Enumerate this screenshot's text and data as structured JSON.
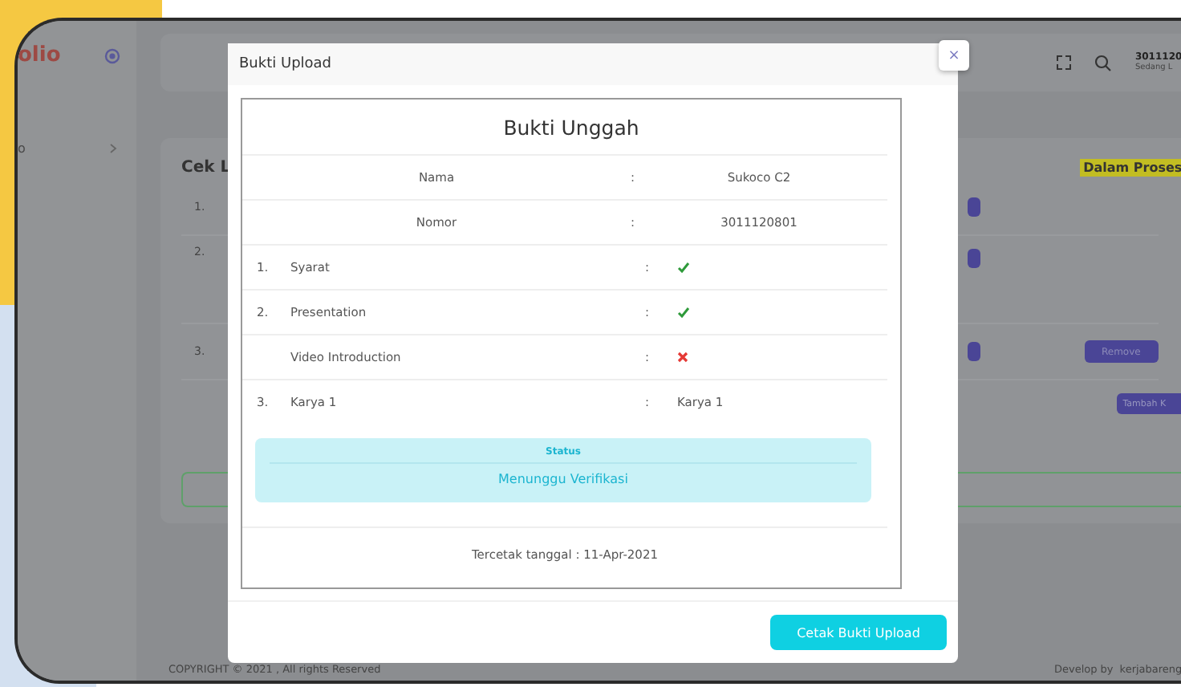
{
  "app": {
    "logo": "olio",
    "sidebar_items": [
      {
        "label": "o"
      }
    ],
    "header": {
      "user_id": "3011120",
      "user_status": "Sedang L"
    },
    "card": {
      "title": "Cek L",
      "badge": "Dalam Proses",
      "rows": [
        {
          "number": "1."
        },
        {
          "number": "2."
        },
        {
          "number": "3.",
          "action": "Remove"
        }
      ],
      "add_button": "Tambah K"
    },
    "footer": {
      "copyright": "COPYRIGHT © 2021 , All rights Reserved",
      "credit_label": "Develop by",
      "credit_link": "kerjabareng"
    }
  },
  "modal": {
    "title": "Bukti Upload",
    "close": "×",
    "heading": "Bukti Unggah",
    "info": [
      {
        "label": "Nama",
        "value": "Sukoco C2"
      },
      {
        "label": "Nomor",
        "value": "3011120801"
      }
    ],
    "separator": ":",
    "items": [
      {
        "number": "1.",
        "label": "Syarat",
        "ok": true
      },
      {
        "number": "2.",
        "label": "Presentation",
        "ok": true
      },
      {
        "label": "Video Introduction",
        "ok": false
      },
      {
        "number": "3.",
        "label": "Karya 1",
        "value": "Karya 1"
      }
    ],
    "status": {
      "title": "Status",
      "text": "Menunggu Verifikasi"
    },
    "printed": "Tercetak tanggal : 11-Apr-2021",
    "button": "Cetak Bukti Upload"
  }
}
